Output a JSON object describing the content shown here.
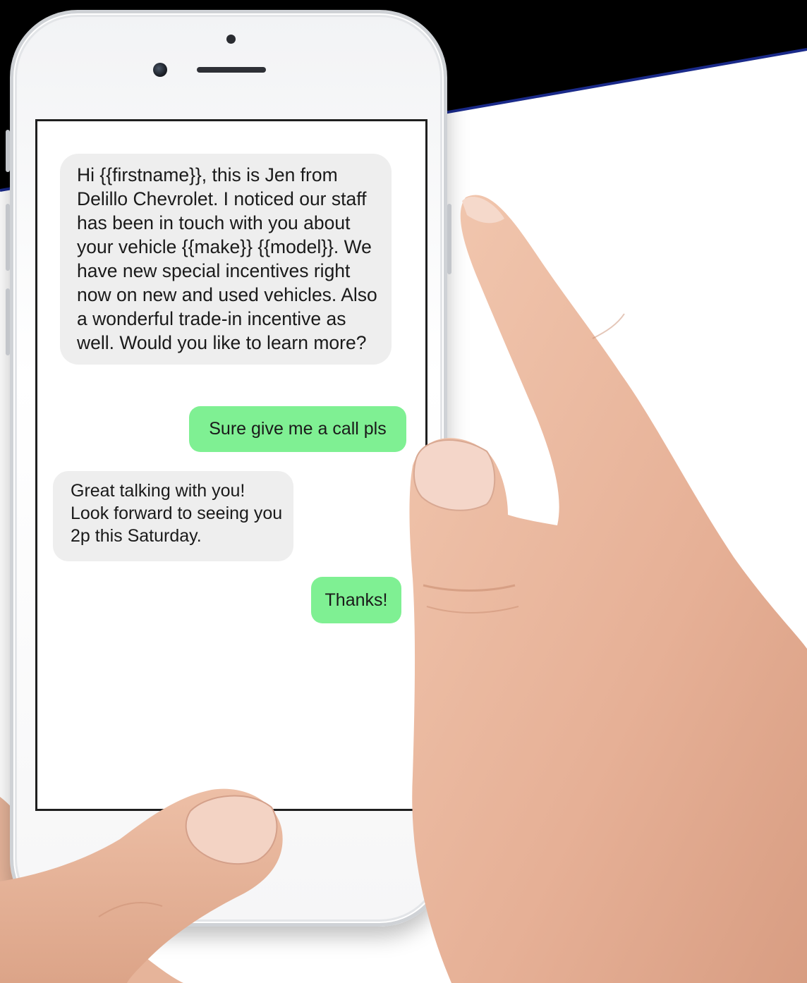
{
  "messages": [
    {
      "direction": "incoming",
      "text": "Hi {{firstname}}, this is Jen from Delillo Chevrolet. I noticed our staff has been in touch with you about your vehicle {{make}} {{model}}. We have new special incentives right now on new and used vehicles.  Also a wonderful trade-in incentive as well.  Would you like to learn more?"
    },
    {
      "direction": "outgoing",
      "text": "Sure give me a call pls"
    },
    {
      "direction": "incoming",
      "text": "Great talking with you! Look forward to seeing you 2p this Saturday."
    },
    {
      "direction": "outgoing",
      "text": "Thanks!"
    }
  ],
  "colors": {
    "incoming_bubble": "#eeeeee",
    "outgoing_bubble": "#7ff093",
    "banner": "#000000",
    "banner_accent": "#1a2a8a",
    "page_background": "#ffffff"
  },
  "icons": [
    "front-camera-icon",
    "speaker-grille-icon"
  ]
}
